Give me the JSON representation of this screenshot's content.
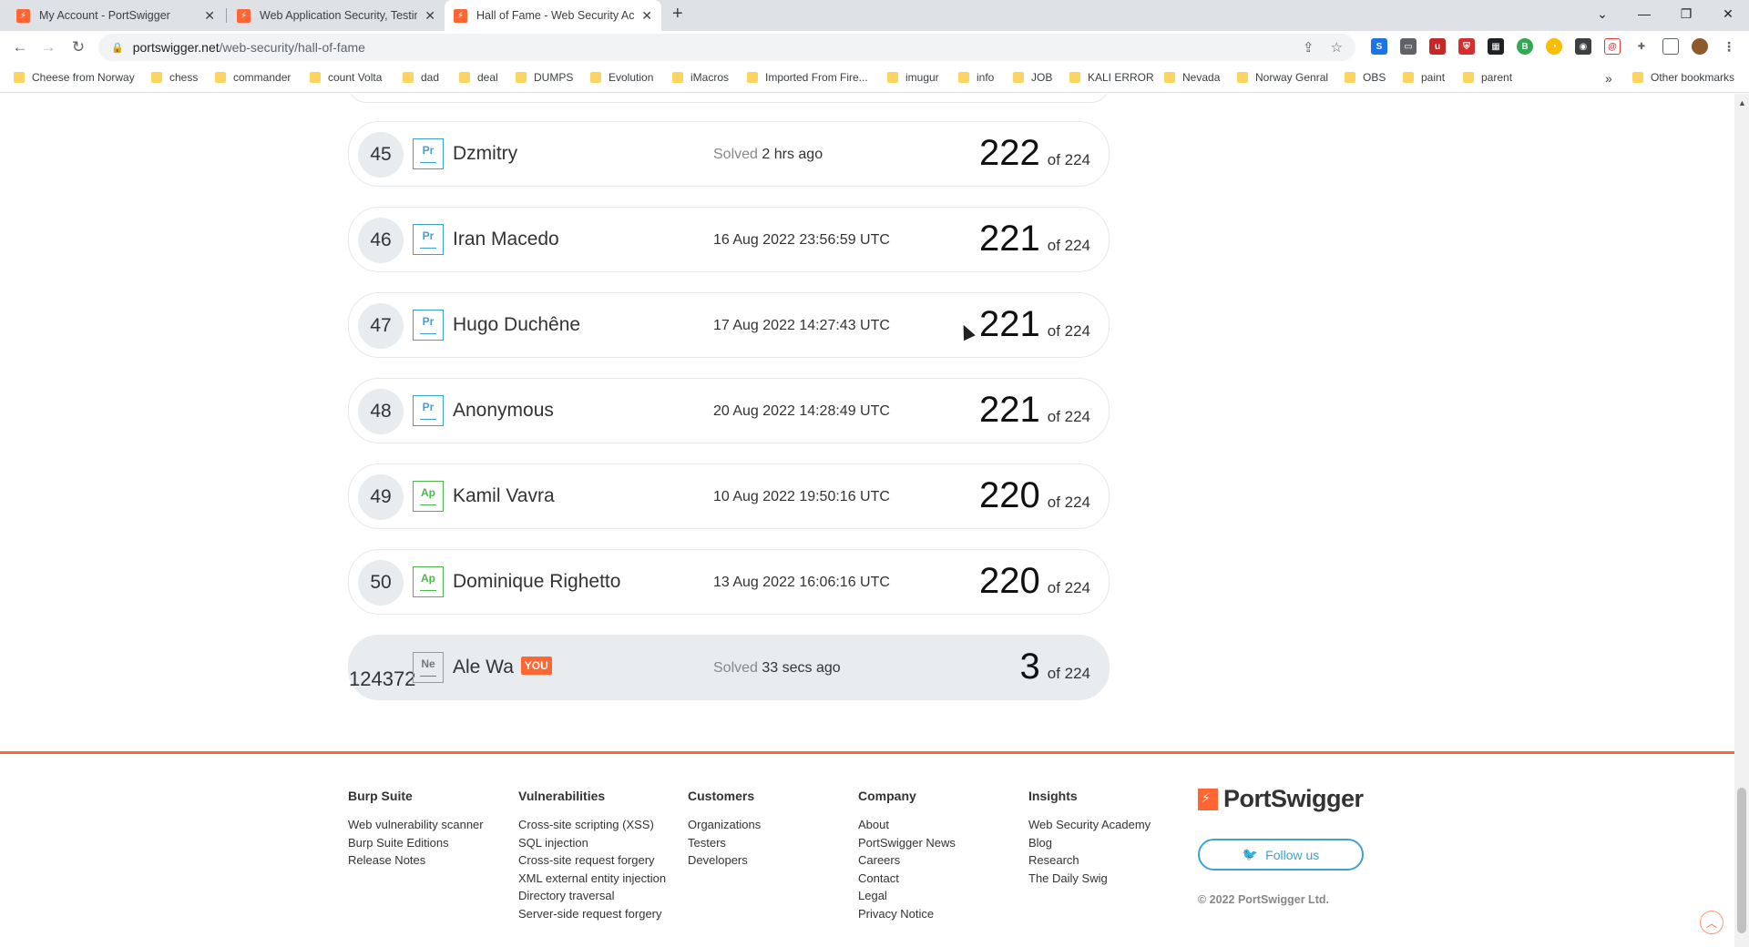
{
  "browser": {
    "tabs": [
      {
        "title": "My Account - PortSwigger",
        "close": "✕"
      },
      {
        "title": "Web Application Security, Testing",
        "close": "✕"
      },
      {
        "title": "Hall of Fame - Web Security Acad",
        "close": "✕"
      }
    ],
    "new_tab": "+",
    "window_controls": [
      "⌄",
      "—",
      "❐",
      "✕"
    ],
    "url_host": "portswigger.net",
    "url_path": "/web-security/hall-of-fame",
    "bookmarks": [
      "Cheese from Norway",
      "chess",
      "commander",
      "count Volta",
      "dad",
      "deal",
      "DUMPS",
      "Evolution",
      "iMacros",
      "Imported From Fire...",
      "imugur",
      "info",
      "JOB",
      "KALI ERROR",
      "Nevada",
      "Norway Genral",
      "OBS",
      "paint",
      "parent"
    ],
    "bookmarks_overflow": "»",
    "other_bookmarks": "Other bookmarks"
  },
  "leaderboard": {
    "of_label": "of 224",
    "solved_label": "Solved",
    "rows": [
      {
        "rank": "45",
        "badge": "Pr",
        "name": "Dzmitry",
        "solved_prefix": "Solved",
        "solved": "2 hrs ago",
        "score": "222"
      },
      {
        "rank": "46",
        "badge": "Pr",
        "name": "Iran Macedo",
        "solved_prefix": "",
        "solved": "16 Aug 2022 23:56:59 UTC",
        "score": "221"
      },
      {
        "rank": "47",
        "badge": "Pr",
        "name": "Hugo Duchêne",
        "solved_prefix": "",
        "solved": "17 Aug 2022 14:27:43 UTC",
        "score": "221"
      },
      {
        "rank": "48",
        "badge": "Pr",
        "name": "Anonymous",
        "solved_prefix": "",
        "solved": "20 Aug 2022 14:28:49 UTC",
        "score": "221"
      },
      {
        "rank": "49",
        "badge": "Ap",
        "name": "Kamil Vavra",
        "solved_prefix": "",
        "solved": "10 Aug 2022 19:50:16 UTC",
        "score": "220"
      },
      {
        "rank": "50",
        "badge": "Ap",
        "name": "Dominique Righetto",
        "solved_prefix": "",
        "solved": "13 Aug 2022 16:06:16 UTC",
        "score": "220"
      }
    ],
    "you_row": {
      "rank": "124372",
      "badge": "Ne",
      "name": "Ale Wa",
      "you_tag": "YOU",
      "solved_prefix": "Solved",
      "solved": "33 secs ago",
      "score": "3"
    }
  },
  "footer": {
    "columns": [
      {
        "heading": "Burp Suite",
        "links": [
          "Web vulnerability scanner",
          "Burp Suite Editions",
          "Release Notes"
        ]
      },
      {
        "heading": "Vulnerabilities",
        "links": [
          "Cross-site scripting (XSS)",
          "SQL injection",
          "Cross-site request forgery",
          "XML external entity injection",
          "Directory traversal",
          "Server-side request forgery"
        ]
      },
      {
        "heading": "Customers",
        "links": [
          "Organizations",
          "Testers",
          "Developers"
        ]
      },
      {
        "heading": "Company",
        "links": [
          "About",
          "PortSwigger News",
          "Careers",
          "Contact",
          "Legal",
          "Privacy Notice"
        ]
      },
      {
        "heading": "Insights",
        "links": [
          "Web Security Academy",
          "Blog",
          "Research",
          "The Daily Swig"
        ]
      }
    ],
    "brand": "PortSwigger",
    "follow_label": "Follow us",
    "copyright": "© 2022 PortSwigger Ltd."
  },
  "colors": {
    "accent": "#ff6633",
    "pr_badge": "#3ea1d6",
    "ap_badge": "#4cb84c"
  }
}
